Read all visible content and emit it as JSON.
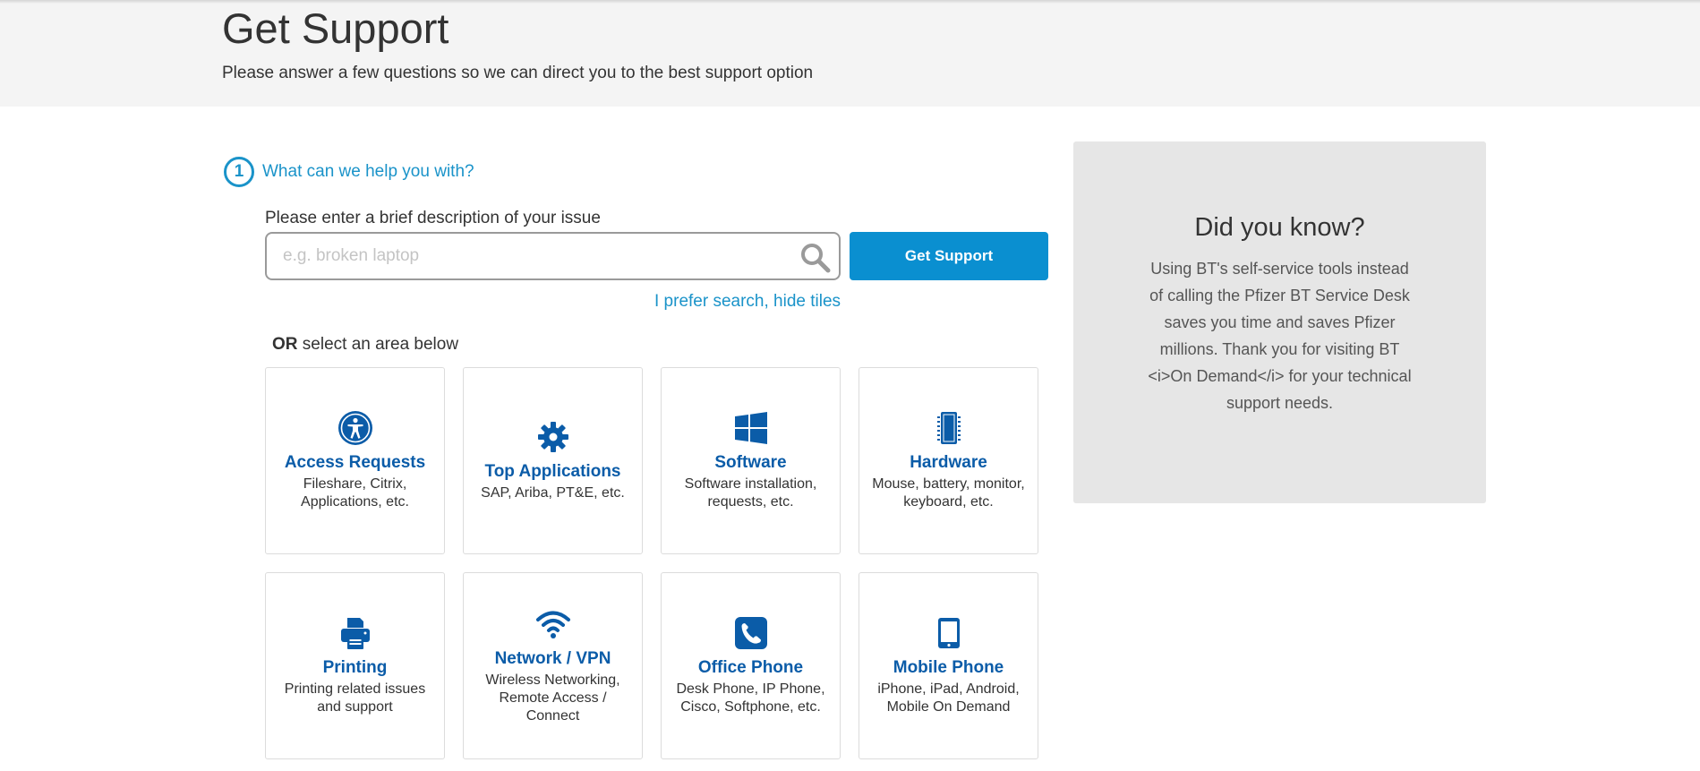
{
  "header": {
    "title": "Get Support",
    "subtitle": "Please answer a few questions so we can direct you to the best support option"
  },
  "step": {
    "number": "1",
    "label": "What can we help you with?"
  },
  "search": {
    "label": "Please enter a brief description of your issue",
    "placeholder": "e.g. broken laptop",
    "value": "",
    "button_label": "Get Support",
    "hide_tiles_link": "I prefer search, hide tiles"
  },
  "select_area": {
    "or": "OR",
    "text": " select an area below"
  },
  "tiles": [
    {
      "icon": "accessibility-icon",
      "title": "Access Requests",
      "desc": "Fileshare, Citrix, Applications, etc."
    },
    {
      "icon": "gear-icon",
      "title": "Top Applications",
      "desc": "SAP, Ariba, PT&E, etc."
    },
    {
      "icon": "windows-icon",
      "title": "Software",
      "desc": "Software installation, requests, etc."
    },
    {
      "icon": "chip-icon",
      "title": "Hardware",
      "desc": "Mouse, battery, monitor, keyboard, etc."
    },
    {
      "icon": "printer-icon",
      "title": "Printing",
      "desc": "Printing related issues and support"
    },
    {
      "icon": "wifi-icon",
      "title": "Network / VPN",
      "desc": "Wireless Networking, Remote Access / Connect"
    },
    {
      "icon": "phone-icon",
      "title": "Office Phone",
      "desc": "Desk Phone, IP Phone, Cisco, Softphone, etc."
    },
    {
      "icon": "tablet-icon",
      "title": "Mobile Phone",
      "desc": "iPhone, iPad, Android, Mobile On Demand"
    }
  ],
  "sidebar": {
    "title": "Did you know?",
    "text": "Using BT's self-service tools instead of calling the Pfizer BT Service Desk saves you time and saves Pfizer millions. Thank you for visiting BT <i>On Demand</i> for your technical support needs."
  },
  "colors": {
    "accent": "#1a93c9",
    "button": "#0a8fd0",
    "tile_title": "#0b5ca8",
    "icon": "#0b5ca8"
  }
}
